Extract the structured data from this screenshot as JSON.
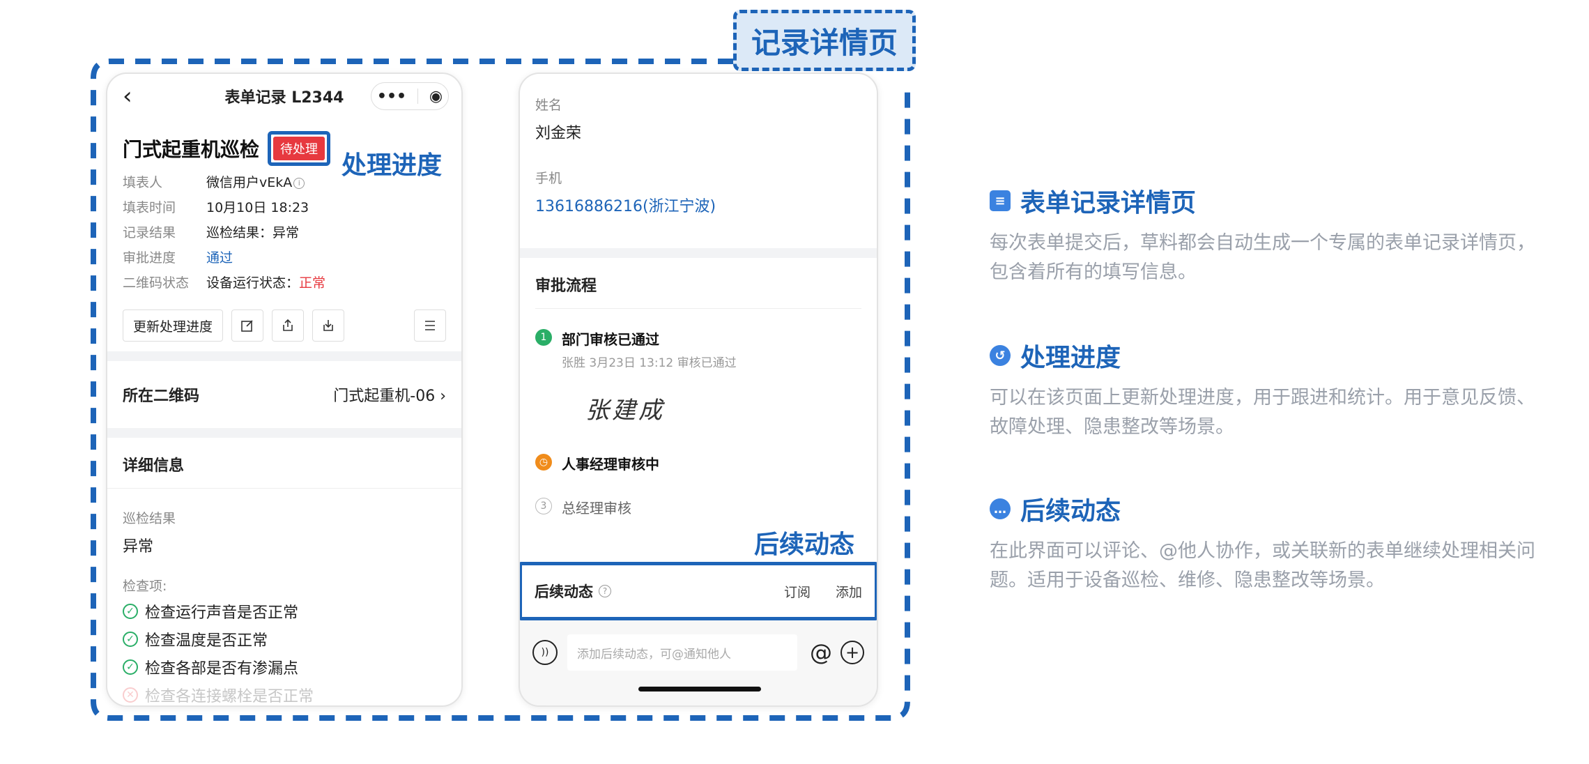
{
  "frame": {
    "title": "记录详情页"
  },
  "callouts": {
    "progress": "处理进度",
    "follow": "后续动态"
  },
  "phone1": {
    "nav_title": "表单记录 L2344",
    "capsule_more": "•••",
    "capsule_close": "◉",
    "record_title": "门式起重机巡检",
    "status_badge": "待处理",
    "fields": [
      {
        "k": "填表人",
        "v": "微信用户vEkA"
      },
      {
        "k": "填表时间",
        "v": "10月10日 18:23"
      },
      {
        "k": "记录结果",
        "v": "巡检结果：异常"
      },
      {
        "k": "审批进度",
        "v": "通过"
      },
      {
        "k": "二维码状态",
        "v": "设备运行状态：",
        "v_red": "正常"
      }
    ],
    "update_button": "更新处理进度",
    "qr_label": "所在二维码",
    "qr_value": "门式起重机-06 ›",
    "detail_title": "详细信息",
    "inspect_label": "巡检结果",
    "inspect_value": "异常",
    "check_label": "检查项:",
    "checks": [
      "检查运行声音是否正常",
      "检查温度是否正常",
      "检查各部是否有渗漏点",
      "检查各连接螺栓是否正常"
    ]
  },
  "phone2": {
    "name_label": "姓名",
    "name_value": "刘金荣",
    "phone_label": "手机",
    "phone_value": "13616886216(浙江宁波)",
    "flow_title": "审批流程",
    "flow": [
      {
        "no": "1",
        "name": "部门审核已通过",
        "sub": "张胜 3月23日 13:12 审核已通过"
      },
      {
        "no": "",
        "name": "人事经理审核中"
      },
      {
        "no": "3",
        "name": "总经理审核"
      }
    ],
    "signature": "张建成",
    "follow_label": "后续动态",
    "follow_subscribe": "订阅",
    "follow_add": "添加",
    "input_placeholder": "添加后续动态，可@通知他人",
    "at_symbol": "@",
    "plus_symbol": "+"
  },
  "features": [
    {
      "icon": "form-icon",
      "title": "表单记录详情页",
      "desc": "每次表单提交后，草料都会自动生成一个专属的表单记录详情页，包含着所有的填写信息。"
    },
    {
      "icon": "history-icon",
      "title": "处理进度",
      "desc": "可以在该页面上更新处理进度，用于跟进和统计。用于意见反馈、故障处理、隐患整改等场景。"
    },
    {
      "icon": "chat-icon",
      "title": "后续动态",
      "desc": "在此界面可以评论、@他人协作，或关联新的表单继续处理相关问题。适用于设备巡检、维修、隐患整改等场景。"
    }
  ],
  "colors": {
    "accent": "#1d64b8",
    "danger": "#e7393f",
    "success": "#2aae67",
    "warning": "#f08c1b"
  }
}
